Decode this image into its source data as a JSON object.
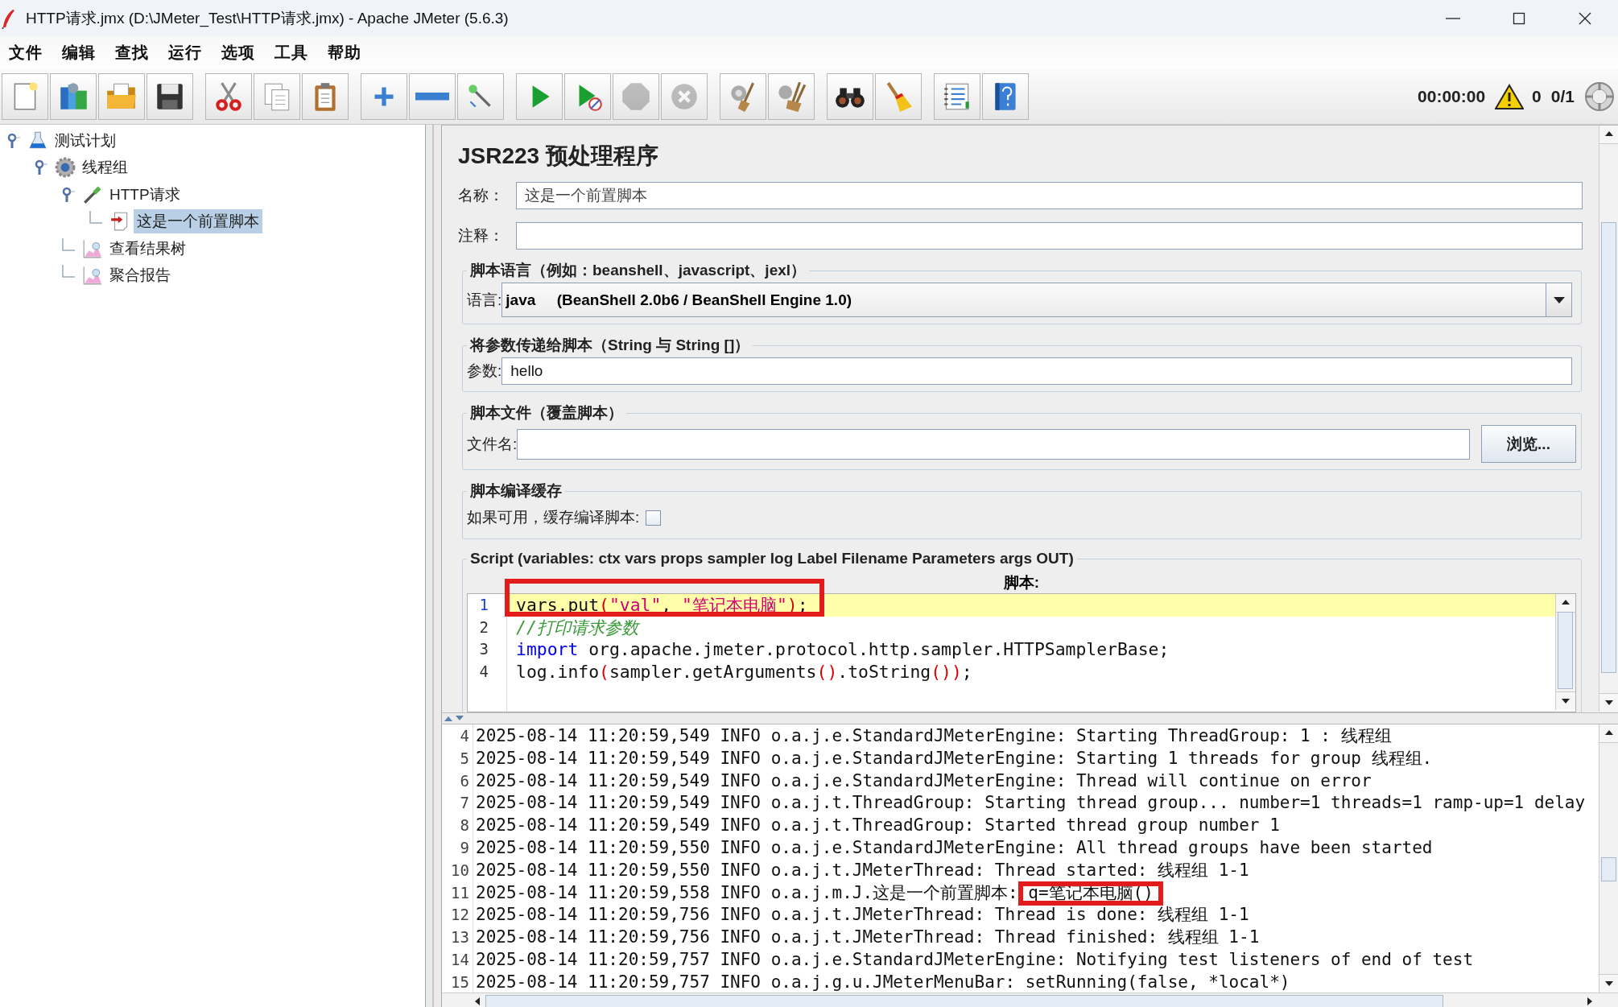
{
  "window": {
    "title": "HTTP请求.jmx (D:\\JMeter_Test\\HTTP请求.jmx) - Apache JMeter (5.6.3)"
  },
  "menu": [
    "文件",
    "编辑",
    "查找",
    "运行",
    "选项",
    "工具",
    "帮助"
  ],
  "toolbar": {
    "groups": [
      [
        {
          "kind": "new",
          "disabled": false
        },
        {
          "kind": "templates",
          "disabled": false
        },
        {
          "kind": "open",
          "disabled": false
        },
        {
          "kind": "save",
          "disabled": false
        }
      ],
      [
        {
          "kind": "cut",
          "disabled": false
        },
        {
          "kind": "copy",
          "disabled": false
        },
        {
          "kind": "paste",
          "disabled": false
        }
      ],
      [
        {
          "kind": "expand",
          "disabled": false
        },
        {
          "kind": "collapse",
          "disabled": false
        },
        {
          "kind": "toggle",
          "disabled": false
        }
      ],
      [
        {
          "kind": "start",
          "disabled": false
        },
        {
          "kind": "start-no-pause",
          "disabled": false
        },
        {
          "kind": "stop",
          "disabled": true
        },
        {
          "kind": "shutdown",
          "disabled": true
        }
      ],
      [
        {
          "kind": "clear",
          "disabled": false
        },
        {
          "kind": "clear-all",
          "disabled": false
        }
      ],
      [
        {
          "kind": "search",
          "disabled": false
        },
        {
          "kind": "reset-search",
          "disabled": false
        }
      ],
      [
        {
          "kind": "function-helper",
          "disabled": false
        },
        {
          "kind": "help",
          "disabled": false
        }
      ]
    ],
    "timer": "00:00:00",
    "errors": "0",
    "threads": "0/1"
  },
  "tree": [
    {
      "label": "测试计划",
      "kind": "test-plan",
      "expanded": true,
      "selected": false,
      "children": [
        {
          "label": "线程组",
          "kind": "thread-group",
          "expanded": true,
          "selected": false,
          "children": [
            {
              "label": "HTTP请求",
              "kind": "sampler",
              "expanded": true,
              "selected": false,
              "children": [
                {
                  "label": "这是一个前置脚本",
                  "kind": "preprocessor",
                  "selected": true
                }
              ]
            },
            {
              "label": "查看结果树",
              "kind": "listener",
              "selected": false
            },
            {
              "label": "聚合报告",
              "kind": "listener",
              "selected": false
            }
          ]
        }
      ]
    }
  ],
  "form": {
    "title": "JSR223 预处理程序",
    "name": {
      "label": "名称：",
      "value": "这是一个前置脚本"
    },
    "comment": {
      "label": "注释："
    },
    "language": {
      "legend": "脚本语言（例如：beanshell、javascript、jexl）",
      "label": "语言:",
      "value": "java",
      "engine": "(BeanShell 2.0b6 / BeanShell Engine 1.0)"
    },
    "parameters": {
      "legend": "将参数传递给脚本（String 与 String []）",
      "label": "参数:",
      "value": "hello"
    },
    "script_file": {
      "legend": "脚本文件（覆盖脚本）",
      "label": "文件名:",
      "button": "浏览..."
    },
    "cache": {
      "legend": "脚本编译缓存",
      "label": "如果可用，缓存编译脚本:",
      "checked": false
    },
    "script": {
      "legend": "Script (variables: ctx vars props sampler log Label Filename Parameters args OUT)",
      "heading": "脚本:",
      "lines": [
        {
          "number": "1",
          "current": true,
          "marked": true,
          "tokens": [
            {
              "kind": "plain",
              "text": "vars.put"
            },
            {
              "kind": "paren",
              "text": "("
            },
            {
              "kind": "string",
              "text": "\"val\""
            },
            {
              "kind": "plain",
              "text": ", "
            },
            {
              "kind": "string",
              "text": "\"笔记本电脑\""
            },
            {
              "kind": "paren",
              "text": ")"
            },
            {
              "kind": "plain",
              "text": ";"
            }
          ]
        },
        {
          "number": "2",
          "current": false,
          "marked": false,
          "tokens": [
            {
              "kind": "comment",
              "text": "//打印请求参数"
            }
          ]
        },
        {
          "number": "3",
          "current": false,
          "marked": false,
          "tokens": [
            {
              "kind": "keyword",
              "text": "import"
            },
            {
              "kind": "plain",
              "text": " org.apache.jmeter.protocol.http.sampler.HTTPSamplerBase;"
            }
          ]
        },
        {
          "number": "4",
          "current": false,
          "marked": false,
          "tokens": [
            {
              "kind": "plain",
              "text": "log.info"
            },
            {
              "kind": "paren",
              "text": "("
            },
            {
              "kind": "plain",
              "text": "sampler.getArguments"
            },
            {
              "kind": "paren",
              "text": "()"
            },
            {
              "kind": "plain",
              "text": ".toString"
            },
            {
              "kind": "paren",
              "text": "())"
            },
            {
              "kind": "plain",
              "text": ";"
            }
          ]
        }
      ]
    }
  },
  "log": {
    "lines": [
      {
        "number": "4",
        "text": "2025-08-14 11:20:59,549 INFO o.a.j.e.StandardJMeterEngine: Starting ThreadGroup: 1 : 线程组"
      },
      {
        "number": "5",
        "text": "2025-08-14 11:20:59,549 INFO o.a.j.e.StandardJMeterEngine: Starting 1 threads for group 线程组."
      },
      {
        "number": "6",
        "text": "2025-08-14 11:20:59,549 INFO o.a.j.e.StandardJMeterEngine: Thread will continue on error"
      },
      {
        "number": "7",
        "text": "2025-08-14 11:20:59,549 INFO o.a.j.t.ThreadGroup: Starting thread group... number=1 threads=1 ramp-up=1 delay"
      },
      {
        "number": "8",
        "text": "2025-08-14 11:20:59,549 INFO o.a.j.t.ThreadGroup: Started thread group number 1"
      },
      {
        "number": "9",
        "text": "2025-08-14 11:20:59,550 INFO o.a.j.e.StandardJMeterEngine: All thread groups have been started"
      },
      {
        "number": "10",
        "text": "2025-08-14 11:20:59,550 INFO o.a.j.t.JMeterThread: Thread started: 线程组 1-1"
      },
      {
        "number": "11",
        "text": "2025-08-14 11:20:59,558 INFO o.a.j.m.J.这是一个前置脚本:",
        "marked": "q=笔记本电脑()"
      },
      {
        "number": "12",
        "text": "2025-08-14 11:20:59,756 INFO o.a.j.t.JMeterThread: Thread is done: 线程组 1-1"
      },
      {
        "number": "13",
        "text": "2025-08-14 11:20:59,756 INFO o.a.j.t.JMeterThread: Thread finished: 线程组 1-1"
      },
      {
        "number": "14",
        "text": "2025-08-14 11:20:59,757 INFO o.a.j.e.StandardJMeterEngine: Notifying test listeners of end of test"
      },
      {
        "number": "15",
        "text": "2025-08-14 11:20:59,757 INFO o.a.j.g.u.JMeterMenuBar: setRunning(false, *local*)"
      }
    ]
  }
}
